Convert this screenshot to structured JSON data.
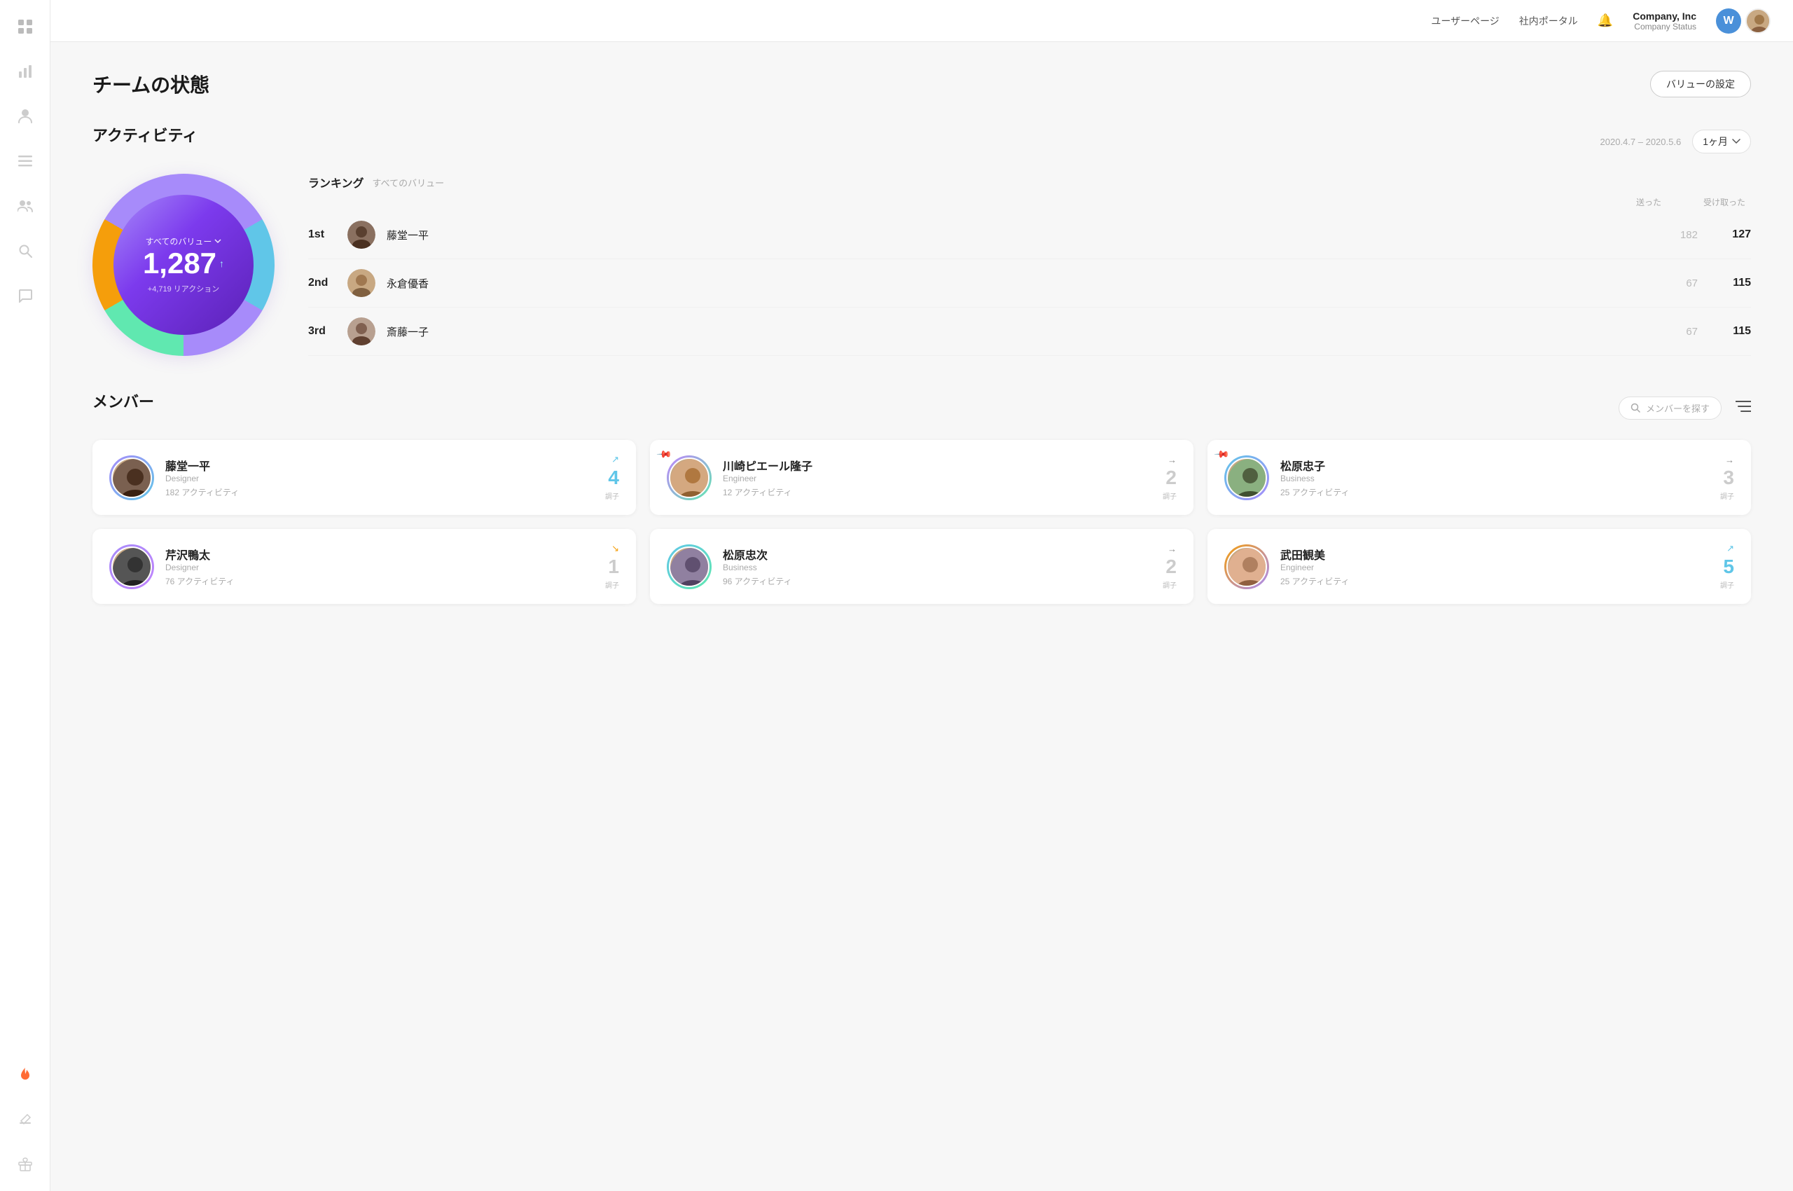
{
  "topnav": {
    "links": [
      "ユーザーページ",
      "社内ポータル"
    ],
    "company_name": "Company, Inc",
    "company_status": "Company Status",
    "bell_label": "notifications"
  },
  "sidebar": {
    "icons": [
      {
        "name": "grid-icon",
        "symbol": "⊞"
      },
      {
        "name": "chart-icon",
        "symbol": "📊"
      },
      {
        "name": "person-icon",
        "symbol": "👤"
      },
      {
        "name": "list-icon",
        "symbol": "☰"
      },
      {
        "name": "team-icon",
        "symbol": "👥"
      },
      {
        "name": "search-icon",
        "symbol": "🔍"
      },
      {
        "name": "chat-icon",
        "symbol": "💬"
      },
      {
        "name": "flame-icon",
        "symbol": "🔥"
      },
      {
        "name": "edit-icon",
        "symbol": "✏️"
      },
      {
        "name": "gift-icon",
        "symbol": "🎁"
      }
    ]
  },
  "page": {
    "title": "チームの状態",
    "setting_button": "バリューの設定"
  },
  "activity": {
    "title": "アクティビティ",
    "date_range": "2020.4.7 – 2020.5.6",
    "period_label": "1ヶ月",
    "donut": {
      "filter_label": "すべてのバリュー",
      "value": "1,287",
      "sub_label": "+4,719 リアクション"
    },
    "ranking": {
      "title": "ランキング",
      "subtitle": "すべてのバリュー",
      "col_sent": "送った",
      "col_received": "受け取った",
      "rows": [
        {
          "rank": "1st",
          "name": "藤堂一平",
          "sent": 182,
          "received": 127
        },
        {
          "rank": "2nd",
          "name": "永倉優香",
          "sent": 67,
          "received": 115
        },
        {
          "rank": "3rd",
          "name": "斎藤一子",
          "sent": 67,
          "received": 115
        }
      ]
    }
  },
  "members": {
    "title": "メンバー",
    "search_placeholder": "メンバーを探す",
    "cards": [
      {
        "name": "藤堂一平",
        "role": "Designer",
        "activity": "182 アクティビティ",
        "score": 4,
        "arrow": "up",
        "pinned": false
      },
      {
        "name": "川崎ピエール隆子",
        "role": "Engineer",
        "activity": "12 アクティビティ",
        "score": 2,
        "arrow": "right",
        "pinned": true
      },
      {
        "name": "松原忠子",
        "role": "Business",
        "activity": "25 アクティビティ",
        "score": 3,
        "arrow": "right",
        "pinned": true
      },
      {
        "name": "芹沢鴨太",
        "role": "Designer",
        "activity": "76 アクティビティ",
        "score": 1,
        "arrow": "down",
        "pinned": false
      },
      {
        "name": "松原忠次",
        "role": "Business",
        "activity": "96 アクティビティ",
        "score": 2,
        "arrow": "right",
        "pinned": false
      },
      {
        "name": "武田観美",
        "role": "Engineer",
        "activity": "25 アクティビティ",
        "score": 5,
        "arrow": "up",
        "pinned": false
      }
    ],
    "score_label": "調子"
  }
}
